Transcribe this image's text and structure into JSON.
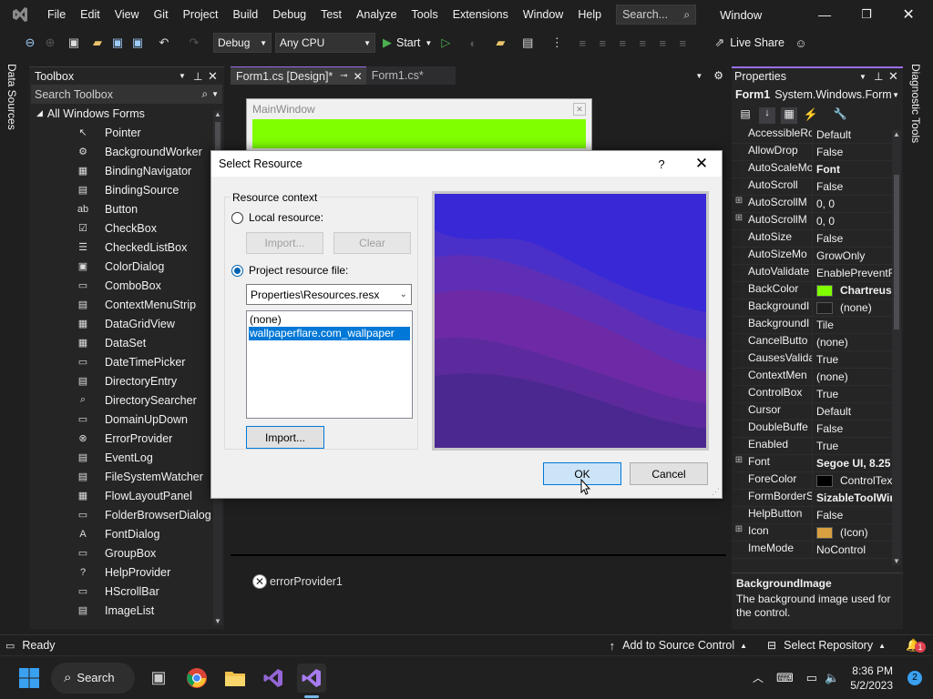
{
  "menu": {
    "items": [
      "File",
      "Edit",
      "View",
      "Git",
      "Project",
      "Build",
      "Debug",
      "Test",
      "Analyze",
      "Tools",
      "Extensions",
      "Window",
      "Help"
    ],
    "search_placeholder": "Search...",
    "window_title": "Window"
  },
  "toolbar": {
    "config": "Debug",
    "platform": "Any CPU",
    "start_label": "Start",
    "live_share": "Live Share"
  },
  "side_tabs": {
    "left": "Data Sources",
    "right": "Diagnostic Tools"
  },
  "toolbox": {
    "title": "Toolbox",
    "search_placeholder": "Search Toolbox",
    "category": "All Windows Forms",
    "items": [
      {
        "label": "Pointer",
        "icon": "↖"
      },
      {
        "label": "BackgroundWorker",
        "icon": "⚙"
      },
      {
        "label": "BindingNavigator",
        "icon": "▦"
      },
      {
        "label": "BindingSource",
        "icon": "▤"
      },
      {
        "label": "Button",
        "icon": "ab"
      },
      {
        "label": "CheckBox",
        "icon": "☑"
      },
      {
        "label": "CheckedListBox",
        "icon": "☰"
      },
      {
        "label": "ColorDialog",
        "icon": "▣"
      },
      {
        "label": "ComboBox",
        "icon": "▭"
      },
      {
        "label": "ContextMenuStrip",
        "icon": "▤"
      },
      {
        "label": "DataGridView",
        "icon": "▦"
      },
      {
        "label": "DataSet",
        "icon": "▦"
      },
      {
        "label": "DateTimePicker",
        "icon": "▭"
      },
      {
        "label": "DirectoryEntry",
        "icon": "▤"
      },
      {
        "label": "DirectorySearcher",
        "icon": "⌕"
      },
      {
        "label": "DomainUpDown",
        "icon": "▭"
      },
      {
        "label": "ErrorProvider",
        "icon": "⊗"
      },
      {
        "label": "EventLog",
        "icon": "▤"
      },
      {
        "label": "FileSystemWatcher",
        "icon": "▤"
      },
      {
        "label": "FlowLayoutPanel",
        "icon": "▦"
      },
      {
        "label": "FolderBrowserDialog",
        "icon": "▭"
      },
      {
        "label": "FontDialog",
        "icon": "A"
      },
      {
        "label": "GroupBox",
        "icon": "▭"
      },
      {
        "label": "HelpProvider",
        "icon": "?"
      },
      {
        "label": "HScrollBar",
        "icon": "▭"
      },
      {
        "label": "ImageList",
        "icon": "▤"
      }
    ]
  },
  "editor": {
    "tabs": [
      {
        "label": "Form1.cs [Design]*",
        "active": true
      },
      {
        "label": "Form1.cs*",
        "active": false
      }
    ],
    "form_title": "MainWindow",
    "form_backcolor": "#7fff00",
    "component": "errorProvider1"
  },
  "properties": {
    "title": "Properties",
    "object": "Form1",
    "object_type": "System.Windows.Forms",
    "rows": [
      {
        "name": "AccessibleRo",
        "value": "Default",
        "bold": false,
        "exp": ""
      },
      {
        "name": "AllowDrop",
        "value": "False",
        "bold": false,
        "exp": ""
      },
      {
        "name": "AutoScaleMo",
        "value": "Font",
        "bold": true,
        "exp": ""
      },
      {
        "name": "AutoScroll",
        "value": "False",
        "bold": false,
        "exp": ""
      },
      {
        "name": "AutoScrollM",
        "value": "0, 0",
        "bold": false,
        "exp": "⊞"
      },
      {
        "name": "AutoScrollM",
        "value": "0, 0",
        "bold": false,
        "exp": "⊞"
      },
      {
        "name": "AutoSize",
        "value": "False",
        "bold": false,
        "exp": ""
      },
      {
        "name": "AutoSizeMo",
        "value": "GrowOnly",
        "bold": false,
        "exp": ""
      },
      {
        "name": "AutoValidate",
        "value": "EnablePreventF",
        "bold": false,
        "exp": ""
      },
      {
        "name": "BackColor",
        "value": "Chartreuse",
        "bold": true,
        "exp": "",
        "swatch": "#7fff00"
      },
      {
        "name": "BackgroundI",
        "value": "(none)",
        "bold": false,
        "exp": "",
        "swatch": "#1e1e1e"
      },
      {
        "name": "BackgroundI",
        "value": "Tile",
        "bold": false,
        "exp": ""
      },
      {
        "name": "CancelButto",
        "value": "(none)",
        "bold": false,
        "exp": ""
      },
      {
        "name": "CausesValida",
        "value": "True",
        "bold": false,
        "exp": ""
      },
      {
        "name": "ContextMen",
        "value": "(none)",
        "bold": false,
        "exp": ""
      },
      {
        "name": "ControlBox",
        "value": "True",
        "bold": false,
        "exp": ""
      },
      {
        "name": "Cursor",
        "value": "Default",
        "bold": false,
        "exp": ""
      },
      {
        "name": "DoubleBuffe",
        "value": "False",
        "bold": false,
        "exp": ""
      },
      {
        "name": "Enabled",
        "value": "True",
        "bold": false,
        "exp": ""
      },
      {
        "name": "Font",
        "value": "Segoe UI, 8.25",
        "bold": true,
        "exp": "⊞"
      },
      {
        "name": "ForeColor",
        "value": "ControlTex",
        "bold": false,
        "exp": "",
        "swatch": "#000000"
      },
      {
        "name": "FormBorderS",
        "value": "SizableToolWin",
        "bold": true,
        "exp": ""
      },
      {
        "name": "HelpButton",
        "value": "False",
        "bold": false,
        "exp": ""
      },
      {
        "name": "Icon",
        "value": "(Icon)",
        "bold": false,
        "exp": "⊞",
        "swatch": "#d8a040"
      },
      {
        "name": "ImeMode",
        "value": "NoControl",
        "bold": false,
        "exp": ""
      }
    ],
    "desc_title": "BackgroundImage",
    "desc_text": "The background image used for the control."
  },
  "dialog": {
    "title": "Select Resource",
    "help": "?",
    "group_label": "Resource context",
    "local_label": "Local resource:",
    "import_small": "Import...",
    "clear": "Clear",
    "project_label": "Project resource file:",
    "resx": "Properties\\Resources.resx",
    "list": [
      "(none)",
      "wallpaperflare.com_wallpaper"
    ],
    "selected_index": 1,
    "import": "Import...",
    "ok": "OK",
    "cancel": "Cancel"
  },
  "status": {
    "ready": "Ready",
    "source_control": "Add to Source Control",
    "repository": "Select Repository",
    "notifications": "1"
  },
  "taskbar": {
    "search": "Search",
    "time": "8:36 PM",
    "date": "5/2/2023",
    "badge": "2"
  }
}
